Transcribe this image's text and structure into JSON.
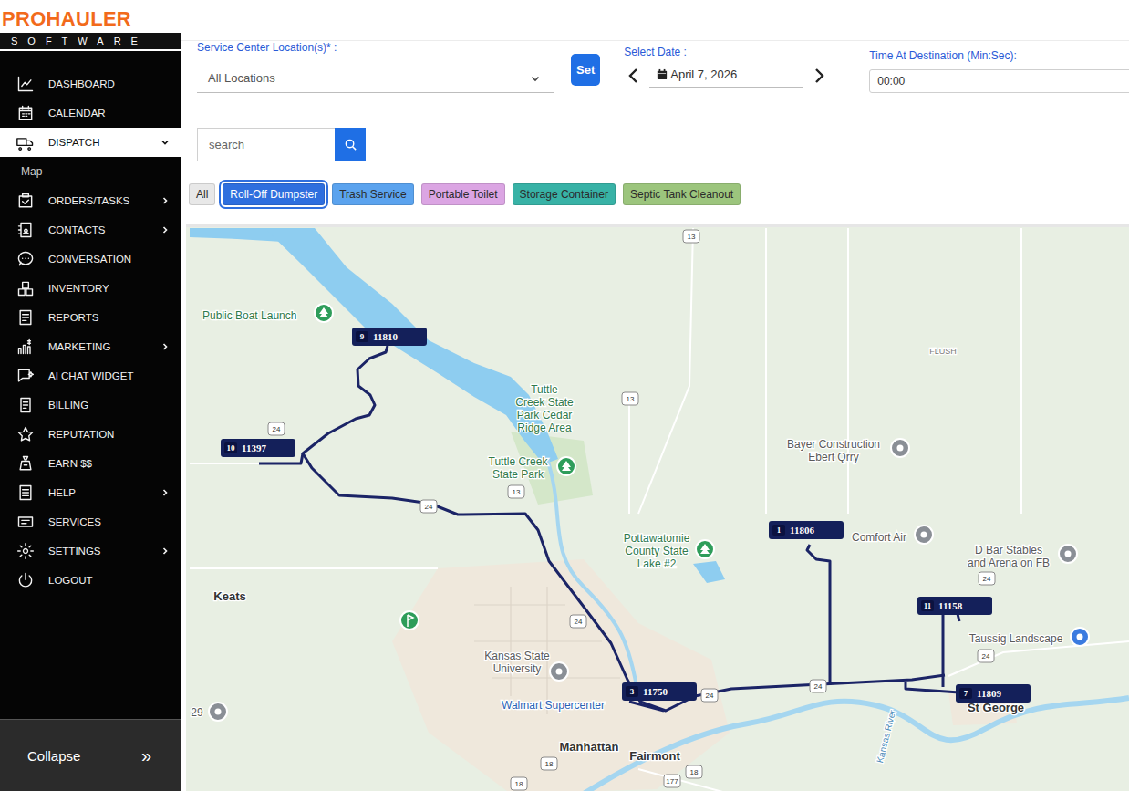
{
  "logo": {
    "brand": "PROHAULER",
    "tagline": "SOFTWARE"
  },
  "sidebar": {
    "items": [
      {
        "label": "DASHBOARD",
        "kind": "link",
        "selected": false,
        "expanded": false,
        "children": []
      },
      {
        "label": "CALENDAR",
        "kind": "link",
        "selected": false,
        "expanded": false,
        "children": []
      },
      {
        "label": "DISPATCH",
        "kind": "group",
        "selected": true,
        "expanded": true,
        "children": [
          {
            "label": "Map",
            "selected": false
          }
        ]
      },
      {
        "label": "ORDERS/TASKS",
        "kind": "group",
        "selected": false,
        "expanded": false,
        "children": []
      },
      {
        "label": "CONTACTS",
        "kind": "group",
        "selected": false,
        "expanded": false,
        "children": []
      },
      {
        "label": "CONVERSATION",
        "kind": "link",
        "selected": false,
        "expanded": false,
        "children": []
      },
      {
        "label": "INVENTORY",
        "kind": "link",
        "selected": false,
        "expanded": false,
        "children": []
      },
      {
        "label": "REPORTS",
        "kind": "link",
        "selected": false,
        "expanded": false,
        "children": []
      },
      {
        "label": "MARKETING",
        "kind": "group",
        "selected": false,
        "expanded": false,
        "children": []
      },
      {
        "label": "AI CHAT WIDGET",
        "kind": "link",
        "selected": false,
        "expanded": false,
        "children": []
      },
      {
        "label": "BILLING",
        "kind": "link",
        "selected": false,
        "expanded": false,
        "children": []
      },
      {
        "label": "REPUTATION",
        "kind": "link",
        "selected": false,
        "expanded": false,
        "children": []
      },
      {
        "label": "EARN $$",
        "kind": "link",
        "selected": false,
        "expanded": false,
        "children": []
      },
      {
        "label": "HELP",
        "kind": "group",
        "selected": false,
        "expanded": false,
        "children": []
      },
      {
        "label": "SERVICES",
        "kind": "link",
        "selected": false,
        "expanded": false,
        "children": []
      },
      {
        "label": "SETTINGS",
        "kind": "group",
        "selected": false,
        "expanded": false,
        "children": []
      },
      {
        "label": "LOGOUT",
        "kind": "link",
        "selected": false,
        "expanded": false,
        "children": []
      }
    ],
    "collapse": {
      "label": "Collapse",
      "glyph": "»"
    }
  },
  "filters": {
    "location": {
      "label": "Service Center Location(s)* :",
      "value": "All Locations"
    },
    "set_button": "Set",
    "date": {
      "label": "Select Date :",
      "value": "April 7, 2026"
    },
    "time": {
      "label": "Time At Destination (Min:Sec):",
      "value": "00:00"
    }
  },
  "search": {
    "placeholder": "search"
  },
  "chips": [
    {
      "label": "All",
      "selected": false,
      "color": "#e8e8e8"
    },
    {
      "label": "Roll-Off Dumpster",
      "selected": true,
      "color": "#2f6fde"
    },
    {
      "label": "Trash Service",
      "selected": false,
      "color": "#5ba3ee"
    },
    {
      "label": "Portable Toilet",
      "selected": false,
      "color": "#dba5e3"
    },
    {
      "label": "Storage Container",
      "selected": false,
      "color": "#38b2a6"
    },
    {
      "label": "Septic Tank Cleanout",
      "selected": false,
      "color": "#9cc57d"
    }
  ],
  "map": {
    "labels": [
      {
        "lines": [
          "Public Boat Launch"
        ],
        "kind": "park"
      },
      {
        "lines": [
          "Tuttle",
          "Creek State",
          "Park Cedar",
          "Ridge Area"
        ],
        "kind": "park-area"
      },
      {
        "lines": [
          "Tuttle Creek",
          "State Park"
        ],
        "kind": "park"
      },
      {
        "lines": [
          "Pottawatomie",
          "County State",
          "Lake #2"
        ],
        "kind": "park"
      },
      {
        "lines": [
          "Bayer Construction",
          "Ebert Qrry"
        ],
        "kind": "poi"
      },
      {
        "lines": [
          "Comfort Air"
        ],
        "kind": "poi"
      },
      {
        "lines": [
          "D Bar Stables",
          "and Arena on FB"
        ],
        "kind": "poi"
      },
      {
        "lines": [
          "FLUSH"
        ],
        "kind": "area"
      },
      {
        "lines": [
          "Keats"
        ],
        "kind": "place"
      },
      {
        "lines": [
          "Kansas State",
          "University"
        ],
        "kind": "school"
      },
      {
        "lines": [
          "Walmart Supercenter"
        ],
        "kind": "store"
      },
      {
        "lines": [
          "Manhattan"
        ],
        "kind": "place"
      },
      {
        "lines": [
          "Fairmont"
        ],
        "kind": "place"
      },
      {
        "lines": [
          "Taussig Landscape"
        ],
        "kind": "shop"
      },
      {
        "lines": [
          "St George"
        ],
        "kind": "place"
      },
      {
        "lines": [
          "Kansas River"
        ],
        "kind": "river"
      },
      {
        "lines": [
          "29"
        ],
        "kind": "poi"
      }
    ],
    "shields": [
      "13",
      "13",
      "24",
      "24",
      "13",
      "24",
      "24",
      "24",
      "24",
      "24",
      "18",
      "18",
      "177",
      "18"
    ],
    "stops": [
      {
        "number": "9",
        "order": "11810"
      },
      {
        "number": "10",
        "order": "11397"
      },
      {
        "number": "1",
        "order": "11806"
      },
      {
        "number": "11",
        "order": "11158"
      },
      {
        "number": "3",
        "order": "11750"
      },
      {
        "number": "7",
        "order": "11809"
      }
    ]
  }
}
